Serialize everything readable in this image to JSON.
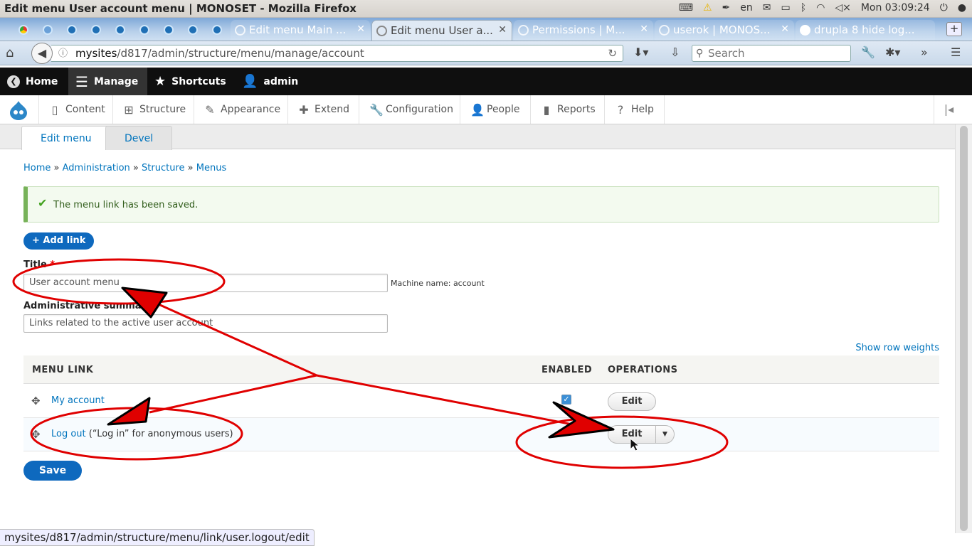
{
  "os": {
    "window_title": "Edit menu User account menu | MONOSET - Mozilla Firefox",
    "lang": "en",
    "clock": "Mon 03:09:24"
  },
  "browser": {
    "tabs": [
      {
        "label": "Edit menu Main ..."
      },
      {
        "label": "Edit menu User a..."
      },
      {
        "label": "Permissions | M..."
      },
      {
        "label": "userok | MONOS..."
      },
      {
        "label": "drupla 8 hide log..."
      }
    ],
    "url_host": "mysites",
    "url_path": "/d817/admin/structure/menu/manage/account",
    "search_placeholder": "Search",
    "status_url": "mysites/d817/admin/structure/menu/link/user.logout/edit"
  },
  "toolbar": {
    "home": "Home",
    "manage": "Manage",
    "shortcuts": "Shortcuts",
    "admin": "admin"
  },
  "tray": {
    "items": [
      "Content",
      "Structure",
      "Appearance",
      "Extend",
      "Configuration",
      "People",
      "Reports",
      "Help"
    ]
  },
  "page": {
    "tabs": [
      "Edit menu",
      "Devel"
    ],
    "breadcrumb": [
      "Home",
      "Administration",
      "Structure",
      "Menus"
    ],
    "breadcrumb_sep": "»",
    "message": "The menu link has been saved.",
    "add_link": "+ Add link",
    "title_label": "Title",
    "title_value": "User account menu",
    "machine_name": "Machine name: account",
    "summary_label": "Administrative summary",
    "summary_value": "Links related to the active user account",
    "show_row_weights": "Show row weights",
    "table": {
      "headers": [
        "MENU LINK",
        "ENABLED",
        "OPERATIONS"
      ],
      "rows": [
        {
          "link": "My account",
          "extra": "",
          "enabled": true,
          "op": "Edit"
        },
        {
          "link": "Log out",
          "extra": " (“Log in” for anonymous users)",
          "enabled": false,
          "op": "Edit"
        }
      ]
    },
    "save": "Save"
  },
  "colors": {
    "link": "#0074bd",
    "primary_button": "#0e69be",
    "success_border": "#77b259",
    "annotation": "#e00000"
  }
}
